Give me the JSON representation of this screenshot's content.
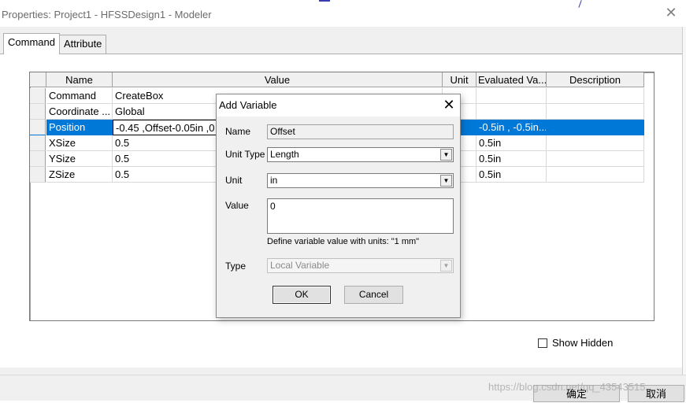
{
  "window": {
    "title": "Properties: Project1 - HFSSDesign1 - Modeler",
    "close_glyph": "✕"
  },
  "tabs": [
    {
      "label": "Command"
    },
    {
      "label": "Attribute"
    }
  ],
  "table": {
    "headers": [
      "Name",
      "Value",
      "Unit",
      "Evaluated Va...",
      "Description"
    ],
    "rows": [
      {
        "name": "Command",
        "value": "CreateBox",
        "unit": "",
        "evaluated": "",
        "description": ""
      },
      {
        "name": "Coordinate ...",
        "value": "Global",
        "unit": "",
        "evaluated": "",
        "description": ""
      },
      {
        "name": "Position",
        "value": "-0.45 ,Offset-0.05in ,0",
        "unit": "",
        "evaluated": "-0.5in , -0.5in...",
        "description": ""
      },
      {
        "name": "XSize",
        "value": "0.5",
        "unit": "",
        "evaluated": "0.5in",
        "description": ""
      },
      {
        "name": "YSize",
        "value": "0.5",
        "unit": "",
        "evaluated": "0.5in",
        "description": ""
      },
      {
        "name": "ZSize",
        "value": "0.5",
        "unit": "",
        "evaluated": "0.5in",
        "description": ""
      }
    ]
  },
  "show_hidden": {
    "label": "Show Hidden",
    "checked": false
  },
  "buttons": {
    "ok": "确定",
    "cancel": "取消"
  },
  "watermark": "https://blog.csdn.net/qq_43543515",
  "dialog": {
    "title": "Add Variable",
    "close_glyph": "✕",
    "name_label": "Name",
    "name_value": "Offset",
    "unit_type_label": "Unit Type",
    "unit_type_value": "Length",
    "unit_label": "Unit",
    "unit_value": "in",
    "value_label": "Value",
    "value_value": "0",
    "hint": "Define variable value with units: \"1 mm\"",
    "type_label": "Type",
    "type_value": "Local Variable",
    "ok_label": "OK",
    "cancel_label": "Cancel"
  },
  "icons": {
    "dropdown": "▼"
  },
  "colors": {
    "selection": "#0078d7",
    "background_lines": "#3b3bb0"
  }
}
